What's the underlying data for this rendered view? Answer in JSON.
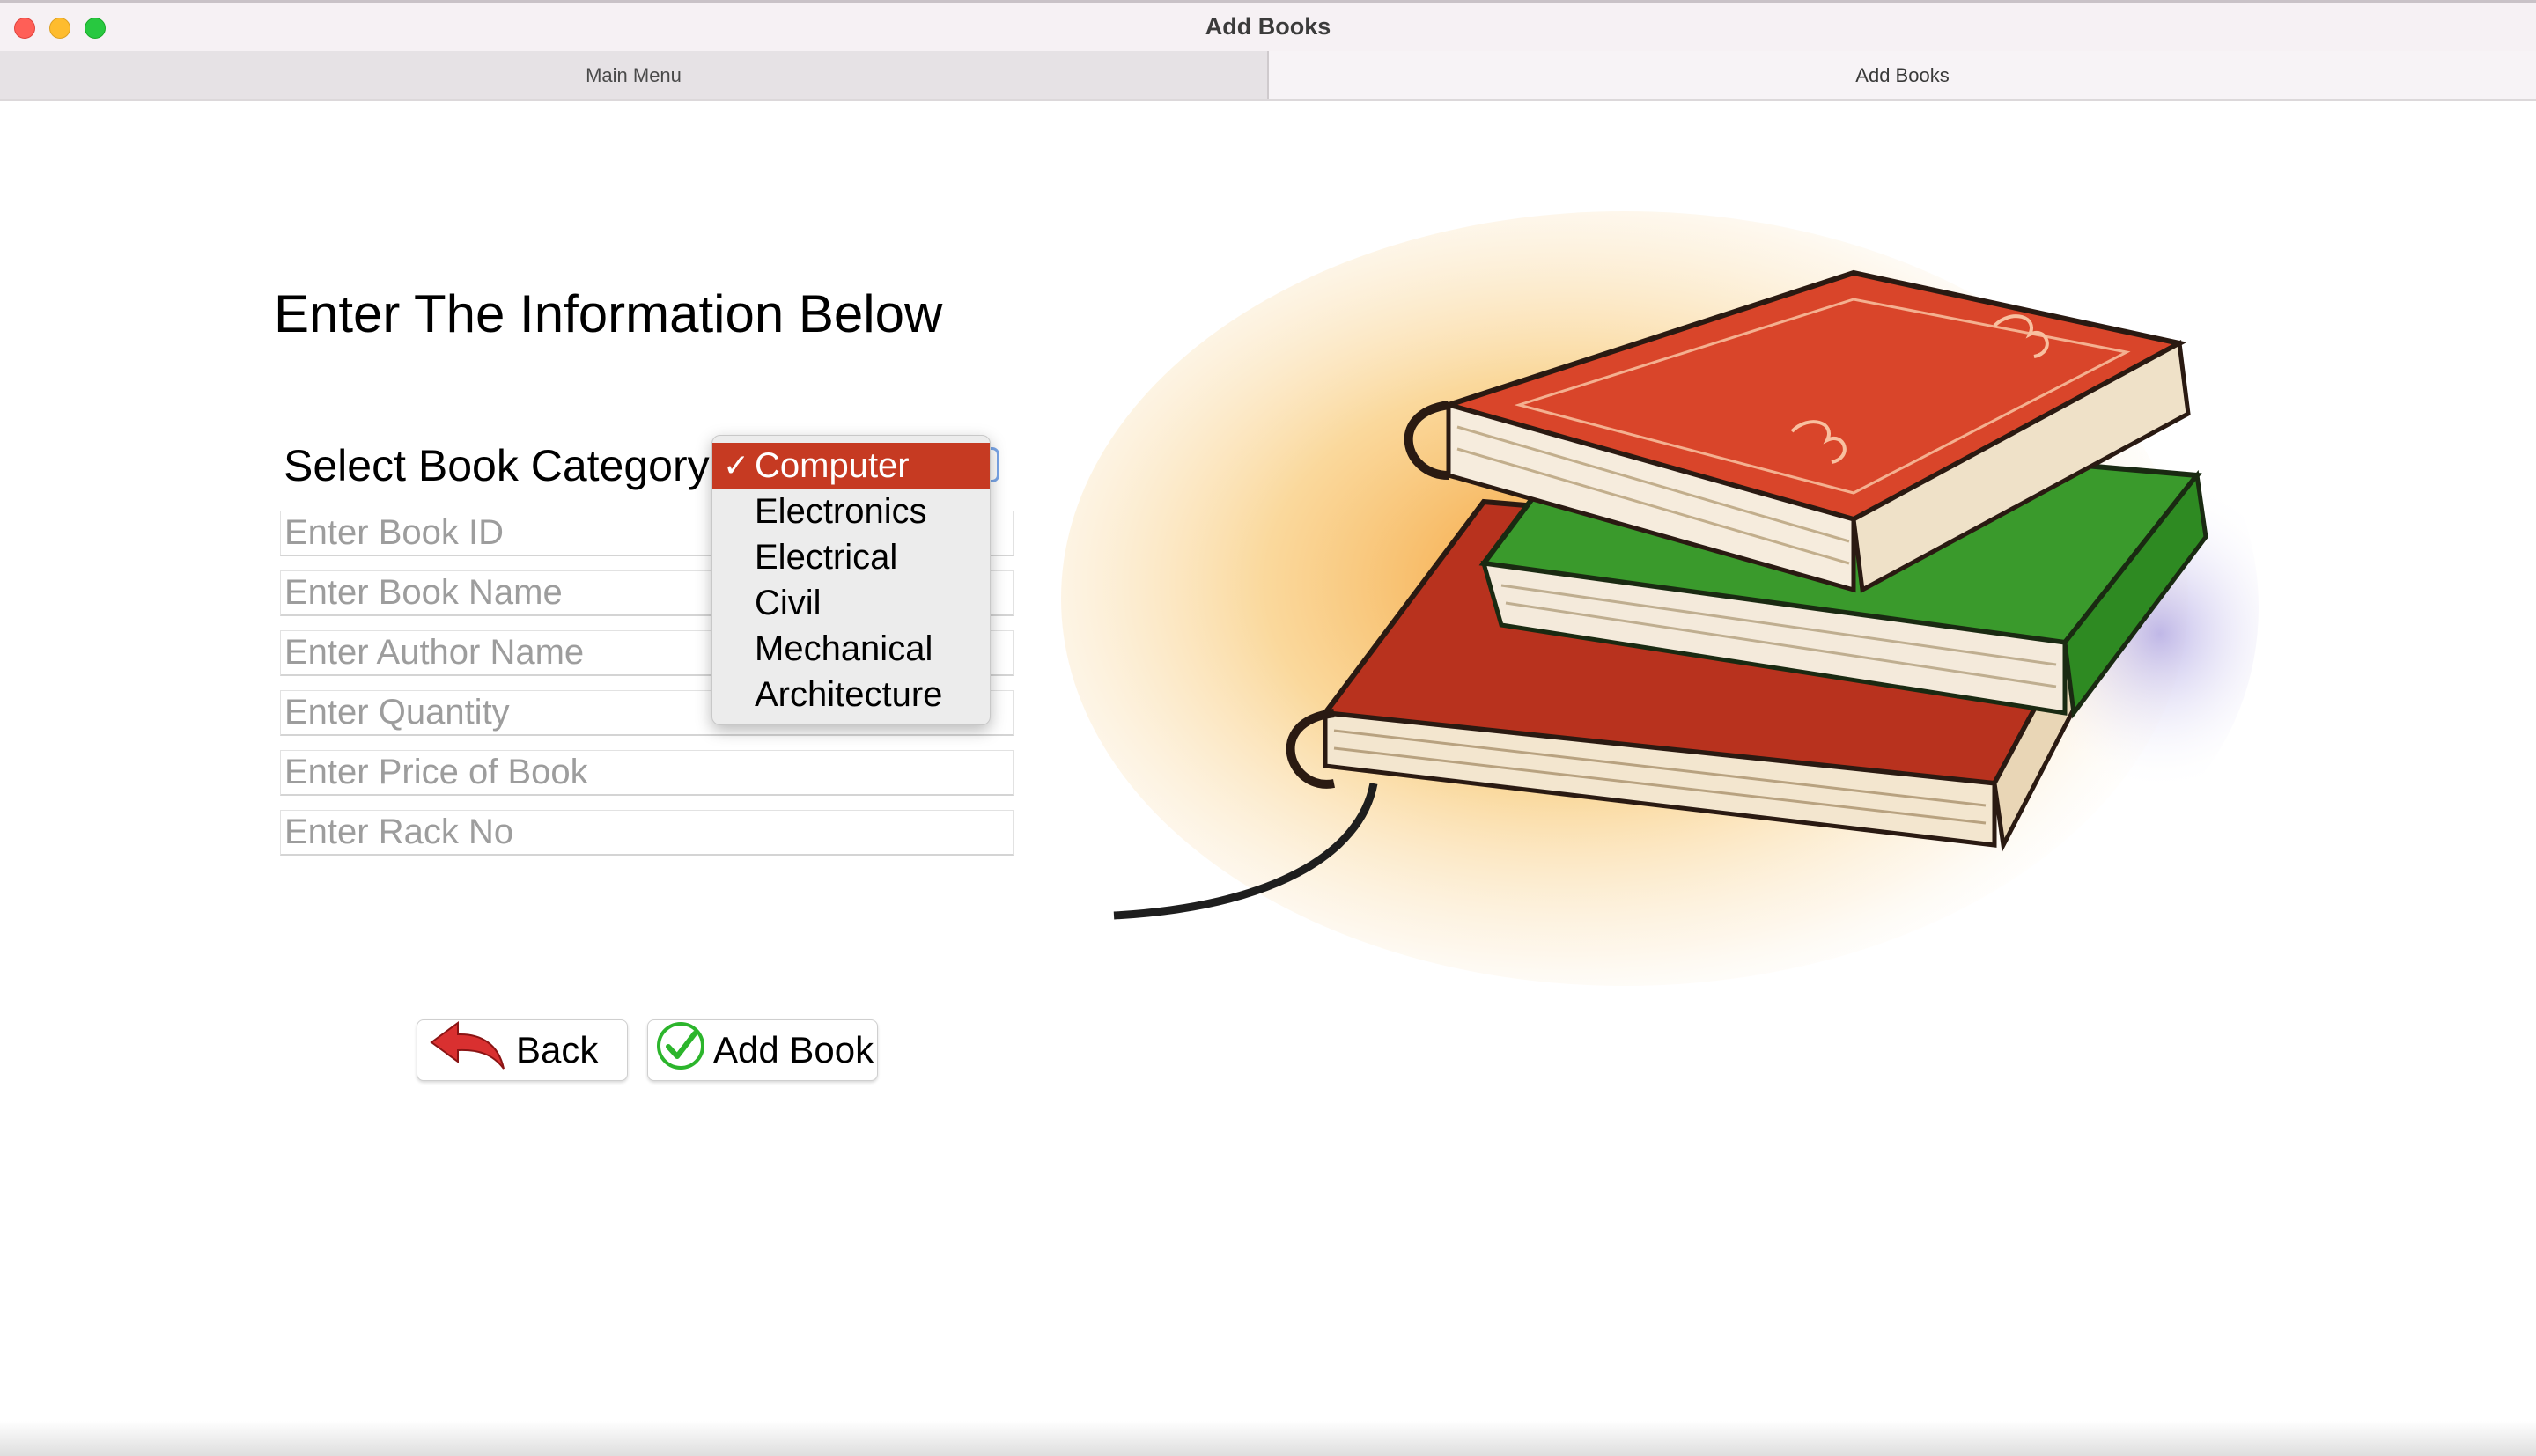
{
  "window": {
    "title": "Add Books"
  },
  "tabs": [
    {
      "label": "Main Menu",
      "active": false
    },
    {
      "label": "Add Books",
      "active": true
    }
  ],
  "form": {
    "heading": "Enter The Information Below",
    "category_label": "Select Book Category",
    "category_selected": "Computer",
    "category_options": [
      "Computer",
      "Electronics",
      "Electrical",
      "Civil",
      "Mechanical",
      "Architecture"
    ],
    "fields": {
      "book_id": {
        "placeholder": "Enter Book ID",
        "value": ""
      },
      "book_name": {
        "placeholder": "Enter Book Name",
        "value": ""
      },
      "author_name": {
        "placeholder": "Enter Author Name",
        "value": ""
      },
      "quantity": {
        "placeholder": "Enter Quantity",
        "value": ""
      },
      "price": {
        "placeholder": "Enter Price of Book",
        "value": ""
      },
      "rack_no": {
        "placeholder": "Enter Rack No",
        "value": ""
      }
    }
  },
  "buttons": {
    "back": {
      "label": "Back",
      "icon": "back-arrow-icon"
    },
    "add": {
      "label": "Add Book",
      "icon": "check-circle-icon"
    }
  },
  "illustration": {
    "icon": "book-stack-illustration"
  },
  "colors": {
    "selection": "#c63a22",
    "focus_ring": "#7aa6e8",
    "check_green": "#2cb52c",
    "back_red": "#d93030"
  }
}
